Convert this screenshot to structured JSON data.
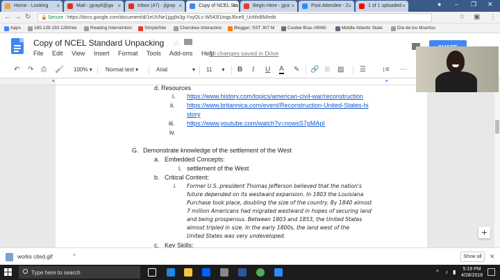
{
  "browser": {
    "tabs": [
      {
        "label": "Home - Looking"
      },
      {
        "label": "Mail - jgray6@ga"
      },
      {
        "label": "Inbox (47) - jlgray"
      },
      {
        "label": "Copy of NCEL Sta"
      },
      {
        "label": "Begin Here - jgra"
      },
      {
        "label": "Post Attendee - Z"
      },
      {
        "label": "1 of 1 uploaded"
      }
    ],
    "secure_label": "Secure",
    "url": "https://docs.google.com/document/d/1eUVNe1jgg9x3g-YxyOLc-W543l1inqpJ6ne9_UcMnBM/edit",
    "bookmarks": [
      {
        "label": "Apps"
      },
      {
        "label": "165.139.150.129/Inte"
      },
      {
        "label": "Reading Intervention"
      },
      {
        "label": "SimpleSite"
      },
      {
        "label": "Cherokee Interaction"
      },
      {
        "label": "Blogger: SST 307 M"
      },
      {
        "label": "Coobie Bras #9060"
      },
      {
        "label": "Middle Atlantic State"
      },
      {
        "label": "Día de los Muertos:"
      }
    ]
  },
  "docs": {
    "title": "Copy of NCEL Standard Unpacking",
    "menu": [
      "File",
      "Edit",
      "View",
      "Insert",
      "Format",
      "Tools",
      "Add-ons",
      "Help"
    ],
    "saved_status": "All changes saved in Drive",
    "share_label": "SHARE",
    "toolbar": {
      "zoom": "100%",
      "style": "Normal text",
      "font": "Arial",
      "size": "11"
    }
  },
  "document": {
    "resources_label": "d.  Resources",
    "res_i": "i.",
    "res_i_link": "https://www.history.com/topics/american-civil-war/reconstruction",
    "res_ii": "ii.",
    "res_ii_link_1": "https://www.britannica.com/event/Reconstruction-United-States-hi",
    "res_ii_link_2": "story",
    "res_iii": "iii.",
    "res_iii_link": "https://www.youtube.com/watch?v=nowsS7pMApI",
    "res_iv": "iv.",
    "g_label": "G.",
    "g_text": "Demonstrate knowledge of the settlement of the West",
    "a_label": "a.",
    "a_text": "Embedded Concepts:",
    "a_i_label": "i.",
    "a_i_text": "settlement of the West",
    "b_label": "b.",
    "b_text": "Critical Content:",
    "b_i_label": "i.",
    "b_lines": [
      "Former U.S. president Thomas Jefferson believed that the nation's",
      "future depended on its westward expansion. In 1803 the Louisiana",
      "Purchase took place, doubling the size of the country. By 1840 almost",
      "7 million Americans had migrated westward in hopes of securing land",
      "and being prosperous. Between 1803 and 1853, the United States",
      "almost tripled in size. In the early 1800s, the land west of the",
      "United States was very undeveloped."
    ],
    "c_label": "c.",
    "c_text": "Key Skills:"
  },
  "downloads": {
    "file": "works cited.gif",
    "show_all": "Show all"
  },
  "taskbar": {
    "search_placeholder": "Type here to search",
    "time": "5:19 PM",
    "date": "4/28/2018"
  }
}
